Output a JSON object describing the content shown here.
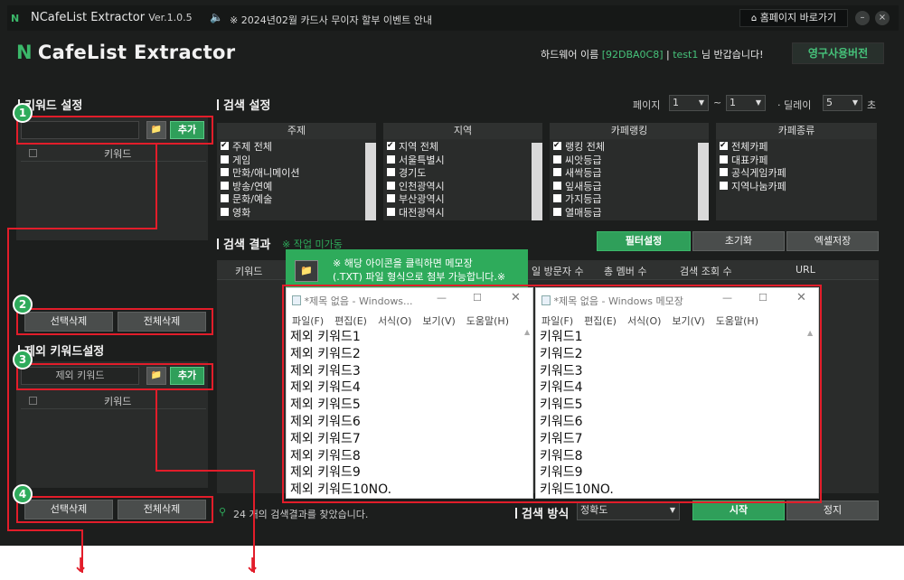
{
  "titlebar": {
    "logo": "N",
    "title": "NCafeList Extractor",
    "version": "Ver.1.0.5",
    "notice": "※ 2024년02월 카드사 무이자 할부 이벤트 안내",
    "home_button": "홈페이지 바로가기"
  },
  "header": {
    "brand_n": "N",
    "brand": "CafeList Extractor",
    "hw_prefix": "하드웨어 이름",
    "hw_id": "[92DBA0C8]",
    "user": "test1",
    "greeting": "님 반갑습니다!",
    "license_button": "영구사용버전"
  },
  "keyword_settings": {
    "title": "키워드 설정",
    "add_button": "추가",
    "column": "키워드",
    "select_delete": "선택삭제",
    "all_delete": "전체삭제"
  },
  "exclude_settings": {
    "title": "제외 키워드설정",
    "input_placeholder": "제외 키워드",
    "add_button": "추가",
    "column": "키워드",
    "select_delete": "선택삭제",
    "all_delete": "전체삭제"
  },
  "search_settings": {
    "title": "검색 설정",
    "page_label": "페이지",
    "page_from": "1",
    "page_to": "1",
    "delay_label": "· 딜레이",
    "delay_value": "5",
    "delay_unit": "초",
    "filters": [
      {
        "header": "주제",
        "items": [
          {
            "label": "주제 전체",
            "checked": true
          },
          {
            "label": "게임",
            "checked": false
          },
          {
            "label": "만화/애니메이션",
            "checked": false
          },
          {
            "label": "방송/연예",
            "checked": false
          },
          {
            "label": "문화/예술",
            "checked": false
          },
          {
            "label": "영화",
            "checked": false
          }
        ]
      },
      {
        "header": "지역",
        "items": [
          {
            "label": "지역 전체",
            "checked": true
          },
          {
            "label": "서울특별시",
            "checked": false
          },
          {
            "label": "경기도",
            "checked": false
          },
          {
            "label": "인천광역시",
            "checked": false
          },
          {
            "label": "부산광역시",
            "checked": false
          },
          {
            "label": "대전광역시",
            "checked": false
          }
        ]
      },
      {
        "header": "카페랭킹",
        "items": [
          {
            "label": "랭킹 전체",
            "checked": true
          },
          {
            "label": "씨앗등급",
            "checked": false
          },
          {
            "label": "새싹등급",
            "checked": false
          },
          {
            "label": "잎새등급",
            "checked": false
          },
          {
            "label": "가지등급",
            "checked": false
          },
          {
            "label": "열매등급",
            "checked": false
          }
        ]
      },
      {
        "header": "카페종류",
        "items": [
          {
            "label": "전체카페",
            "checked": true
          },
          {
            "label": "대표카페",
            "checked": false
          },
          {
            "label": "공식게임카페",
            "checked": false
          },
          {
            "label": "지역나눔카페",
            "checked": false
          }
        ]
      }
    ]
  },
  "results": {
    "title": "검색 결과",
    "status": "※ 작업 미가동",
    "filter_button": "필터설정",
    "reset_button": "초기화",
    "excel_button": "엑셀저장",
    "columns": [
      "키워드",
      "일 방문자 수",
      "총 멤버 수",
      "검색 조회 수",
      "URL"
    ],
    "found": "24 개의 검색결과를 찾았습니다.",
    "method_label": "검색 방식",
    "method_value": "정확도",
    "start_button": "시작",
    "stop_button": "정지"
  },
  "tooltip": {
    "line1": "※ 해당 아이콘을 클릭하면 메모장",
    "line2": "(.TXT) 파일 형식으로 첨부 가능합니다.※"
  },
  "notepad_left": {
    "title": "*제목 없음 - Windows...",
    "menu": [
      "파일(F)",
      "편집(E)",
      "서식(O)",
      "보기(V)",
      "도움말(H)"
    ],
    "lines": [
      "제외 키워드1",
      "제외 키워드2",
      "제외 키워드3",
      "제외 키워드4",
      "제외 키워드5",
      "제외 키워드6",
      "제외 키워드7",
      "제외 키워드8",
      "제외 키워드9",
      "제외 키워드10NO."
    ]
  },
  "notepad_right": {
    "title": "*제목 없음 - Windows 메모장",
    "menu": [
      "파일(F)",
      "편집(E)",
      "서식(O)",
      "보기(V)",
      "도움말(H)"
    ],
    "lines": [
      "키워드1",
      "키워드2",
      "키워드3",
      "키워드4",
      "키워드5",
      "키워드6",
      "키워드7",
      "키워드8",
      "키워드9",
      "키워드10NO."
    ]
  },
  "badges": [
    "1",
    "2",
    "3",
    "4"
  ],
  "colors": {
    "accent": "#2eab5b",
    "highlight": "#e21d2a",
    "background": "#1c1e1d"
  }
}
